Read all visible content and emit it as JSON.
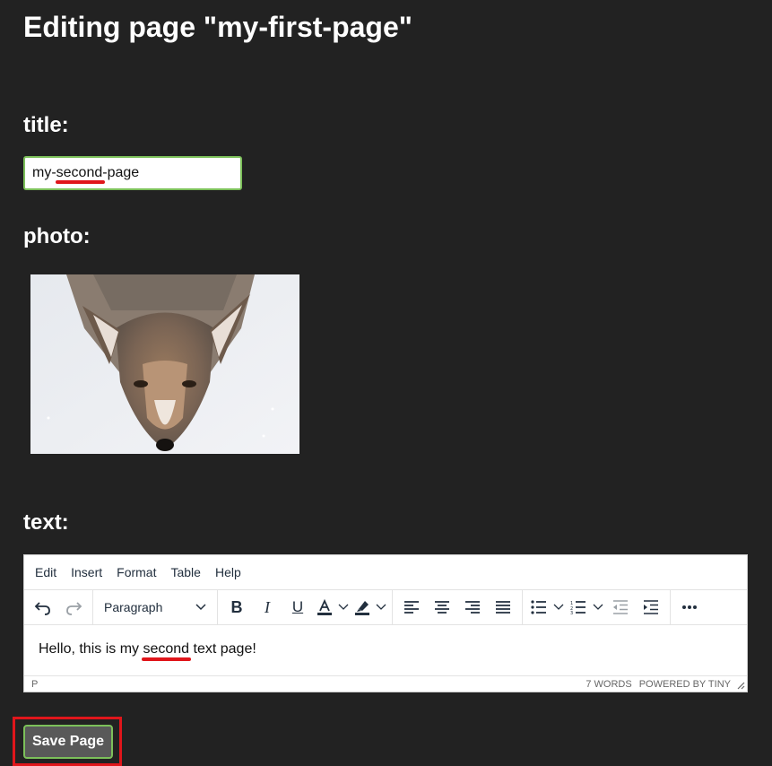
{
  "page": {
    "heading": "Editing page \"my-first-page\""
  },
  "form": {
    "title_label": "title:",
    "title_value": "my-second-page",
    "photo_label": "photo:",
    "text_label": "text:",
    "save_label": "Save Page"
  },
  "editor": {
    "menus": [
      "Edit",
      "Insert",
      "Format",
      "Table",
      "Help"
    ],
    "block_format": "Paragraph",
    "content_before": "Hello, this is my ",
    "content_highlight": "second",
    "content_after": " text page!",
    "status_path": "p",
    "word_count": "7 words",
    "branding": "Powered by Tiny",
    "icons": [
      "undo-icon",
      "redo-icon",
      "bold-icon",
      "italic-icon",
      "underline-icon",
      "text-color-icon",
      "highlight-icon",
      "align-left-icon",
      "align-center-icon",
      "align-right-icon",
      "justify-icon",
      "bullet-list-icon",
      "numbered-list-icon",
      "outdent-icon",
      "indent-icon",
      "more-icon"
    ]
  },
  "colors": {
    "background": "#222222",
    "input_border": "#7cc05a",
    "spell_error": "#e0161b",
    "annotation_box": "#e0161b"
  }
}
